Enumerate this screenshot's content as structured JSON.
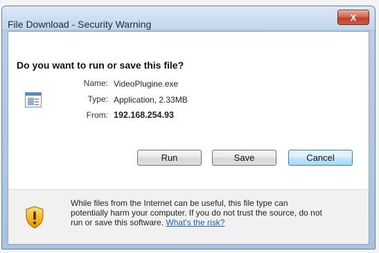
{
  "window": {
    "title": "File Download - Security Warning",
    "close_label": "X"
  },
  "prompt": {
    "question": "Do you want to run or save this file?"
  },
  "file_info": {
    "name_label": "Name:",
    "name_value": "VideoPlugine.exe",
    "type_label": "Type:",
    "type_value": "Application, 2.33MB",
    "from_label": "From:",
    "from_value": "192.168.254.93"
  },
  "buttons": {
    "run": "Run",
    "save": "Save",
    "cancel": "Cancel"
  },
  "warning": {
    "line1": "While files from the Internet can be useful, this file type can",
    "line2": "potentially harm your computer. If you do not trust the source, do not",
    "line3_prefix": "run or save this software. ",
    "link_text": "What's the risk?"
  },
  "icons": {
    "file": "application-file-icon",
    "warning": "security-shield-icon",
    "close": "close-icon"
  },
  "colors": {
    "default_button_border": "#3c7fb1",
    "link": "#1a5fb4",
    "close_button": "#c1412c"
  }
}
